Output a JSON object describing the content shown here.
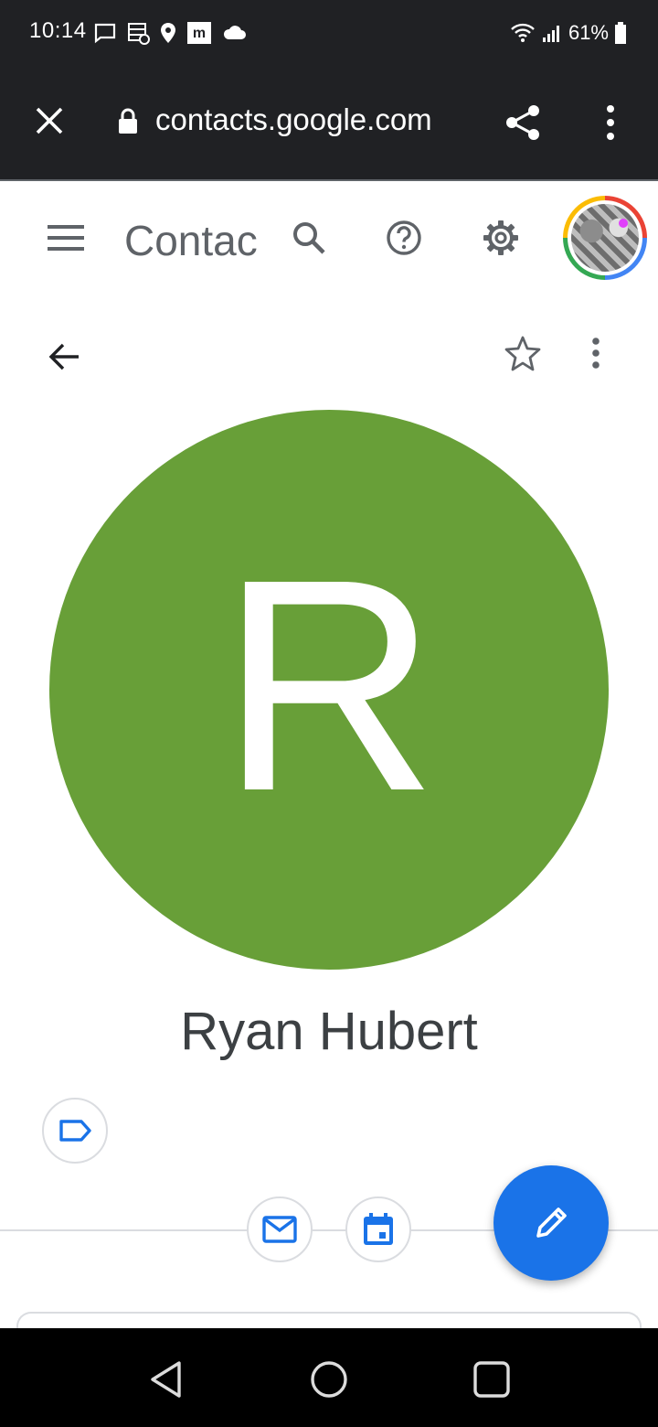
{
  "status_bar": {
    "time": "10:14",
    "battery_percent": "61%",
    "left_icons": [
      "message-icon",
      "data-saver-icon",
      "location-icon",
      "m-app-icon",
      "cloud-icon"
    ],
    "right_icons": [
      "wifi-icon",
      "signal-icon",
      "battery-icon"
    ]
  },
  "browser": {
    "url": "contacts.google.com",
    "icons": [
      "close-icon",
      "lock-icon",
      "share-icon",
      "more-vert-icon"
    ]
  },
  "app_header": {
    "title": "Contac",
    "icons": [
      "hamburger-menu-icon",
      "search-icon",
      "help-icon",
      "settings-gear-icon",
      "account-avatar"
    ]
  },
  "contact": {
    "initial": "R",
    "name": "Ryan Hubert",
    "avatar_color": "#689f38",
    "toolbar_icons": [
      "back-arrow-icon",
      "star-outline-icon",
      "more-vert-icon"
    ],
    "label_icon": "label-icon",
    "actions": [
      "email-icon",
      "calendar-event-icon"
    ],
    "fab_icon": "edit-pencil-icon"
  },
  "colors": {
    "accent": "#1a73e8",
    "status_bar_bg": "#202124",
    "divider": "#dadce0"
  },
  "nav_bar": {
    "icons": [
      "back-triangle-icon",
      "home-circle-icon",
      "recents-square-icon"
    ]
  }
}
